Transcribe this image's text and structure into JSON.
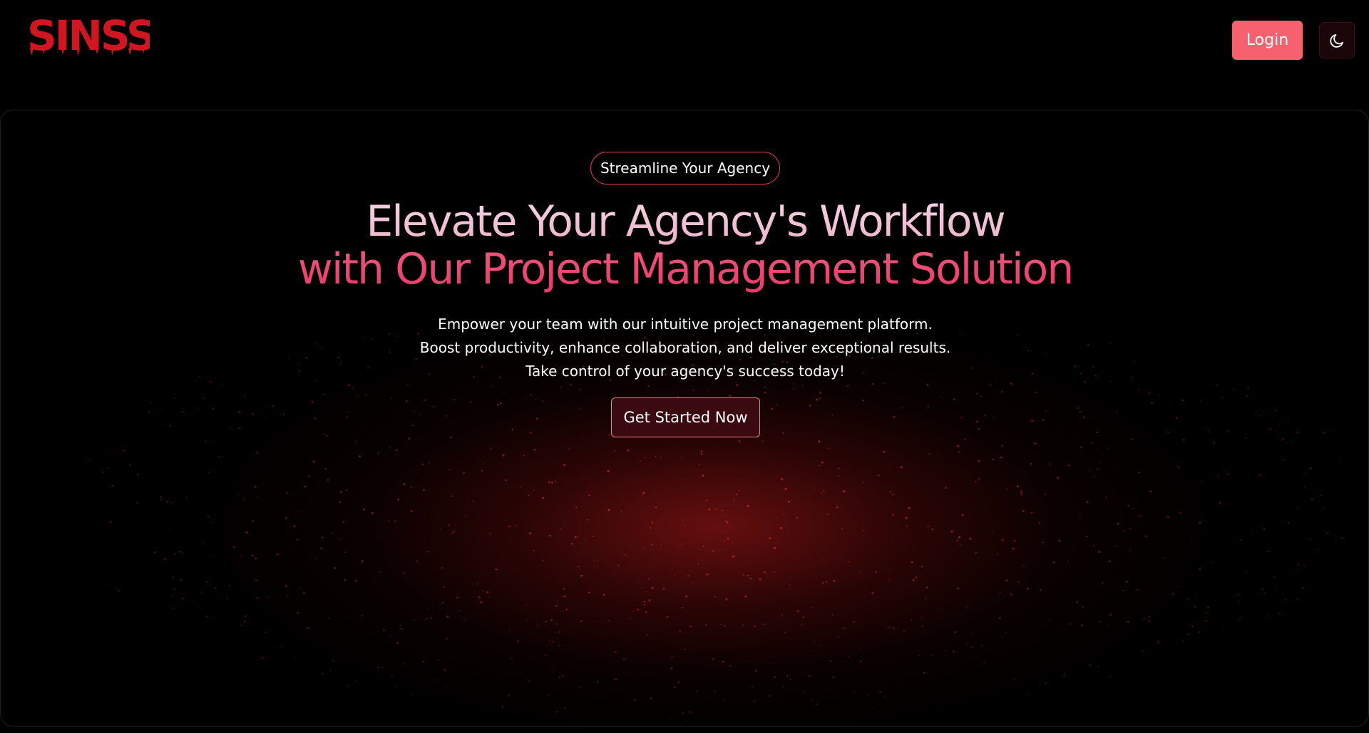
{
  "header": {
    "logo_text": "SINSS",
    "login_label": "Login",
    "theme_icon": "moon-icon"
  },
  "hero": {
    "badge": "Streamline Your Agency",
    "headline_line1": "Elevate Your Agency's Workflow",
    "headline_line2": "with Our Project Management Solution",
    "description_lines": [
      "Empower your team with our intuitive project management platform.",
      "Boost productivity, enhance collaboration, and deliver exceptional results.",
      "Take control of your agency's success today!"
    ],
    "cta_label": "Get Started Now"
  },
  "colors": {
    "background": "#000000",
    "brand_red": "#d01620",
    "login_button": "#f7616f",
    "headline_light_pink": "#f0c0d6",
    "headline_pink": "#ec4a72",
    "badge_border": "#e23e4a",
    "cta_background": "#3a0a10",
    "particle_red": "#d42a2a"
  }
}
